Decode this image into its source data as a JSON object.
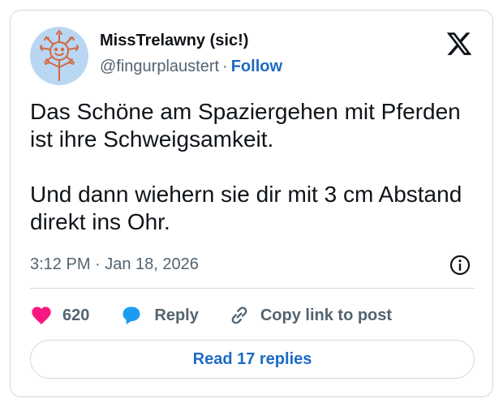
{
  "author": {
    "display_name": "MissTrelawny (sic!)",
    "handle": "@fingurplaustert",
    "separator": "·",
    "follow_label": "Follow",
    "avatar_icon": "hand-drawn-sun-face-avatar"
  },
  "brand": {
    "logo_icon": "x-logo-icon"
  },
  "tweet": {
    "paragraphs": [
      "Das Schöne am Spaziergehen mit Pferden ist ihre Schweigsamkeit.",
      "Und dann wiehern sie dir mit 3 cm Abstand direkt ins Ohr."
    ],
    "timestamp": "3:12 PM · Jan 18, 2026"
  },
  "actions": {
    "like_count": "620",
    "reply_label": "Reply",
    "copy_link_label": "Copy link to post"
  },
  "footer": {
    "read_replies_label": "Read 17 replies"
  },
  "colors": {
    "accent": "#1d6bc4",
    "like": "#f91880",
    "reply_icon": "#1d9bf0",
    "muted": "#536471",
    "border": "#cfd9de",
    "avatar_bg": "#b9d6f2",
    "avatar_ink": "#d2693f"
  }
}
